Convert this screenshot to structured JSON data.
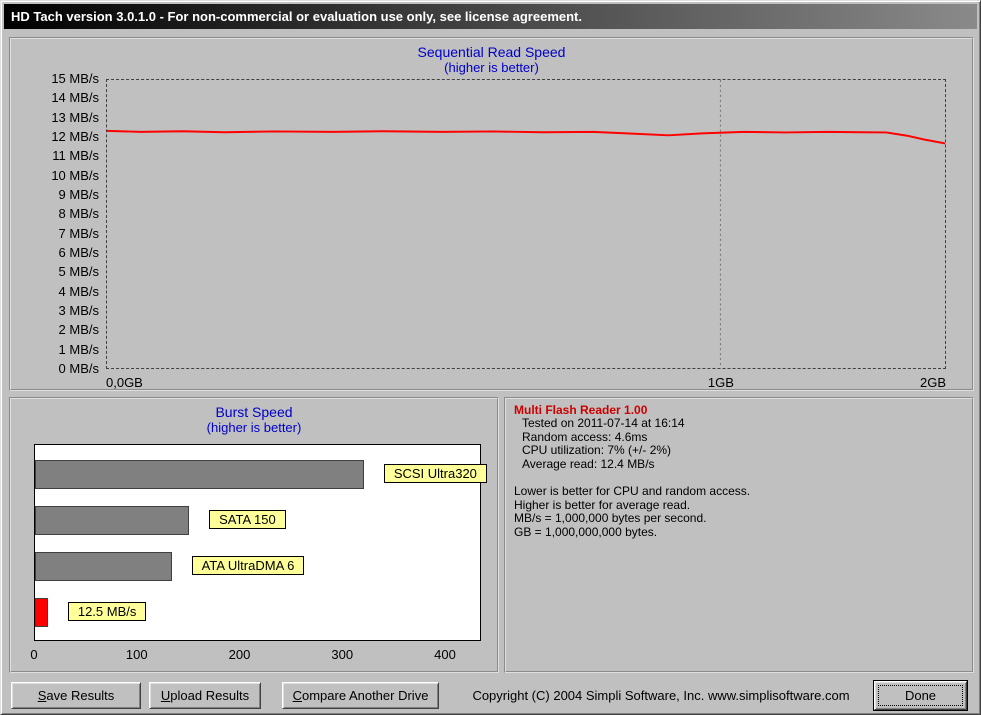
{
  "window": {
    "title": "HD Tach version 3.0.1.0  - For non-commercial or evaluation use only, see license agreement."
  },
  "colors": {
    "accent_blue": "#0000cc",
    "line_red": "#ff0000",
    "bar_gray": "#808080",
    "label_yellow": "#ffff99",
    "drive_title_red": "#cc0000",
    "window_gray": "#c0c0c0"
  },
  "chart_data": [
    {
      "type": "line",
      "title": "Sequential Read Speed",
      "subtitle": "(higher is better)",
      "ylim": [
        0,
        15
      ],
      "ytick_step": 1,
      "ytick_suffix": " MB/s",
      "grid": "dashed-frame",
      "xticks": [
        {
          "label": "0,0GB",
          "pos": 0.0,
          "align": "left"
        },
        {
          "label": "1GB",
          "pos": 0.732,
          "align": "center"
        },
        {
          "label": "2GB",
          "pos": 1.0,
          "align": "right"
        }
      ],
      "gridline_x_positions": [
        0.732
      ],
      "series": [
        {
          "name": "sequential-read-speed",
          "color": "#ff0000",
          "points": [
            [
              0,
              12.35
            ],
            [
              0.04,
              12.3
            ],
            [
              0.09,
              12.33
            ],
            [
              0.14,
              12.28
            ],
            [
              0.2,
              12.32
            ],
            [
              0.27,
              12.3
            ],
            [
              0.33,
              12.33
            ],
            [
              0.4,
              12.3
            ],
            [
              0.46,
              12.32
            ],
            [
              0.52,
              12.28
            ],
            [
              0.58,
              12.3
            ],
            [
              0.63,
              12.2
            ],
            [
              0.67,
              12.12
            ],
            [
              0.71,
              12.22
            ],
            [
              0.76,
              12.3
            ],
            [
              0.81,
              12.27
            ],
            [
              0.86,
              12.3
            ],
            [
              0.9,
              12.28
            ],
            [
              0.93,
              12.27
            ],
            [
              0.955,
              12.1
            ],
            [
              0.975,
              11.9
            ],
            [
              1,
              11.7
            ]
          ]
        }
      ]
    },
    {
      "type": "bar-horizontal",
      "title": "Burst Speed",
      "subtitle": "(higher is better)",
      "xlim": [
        0,
        435
      ],
      "xticks": [
        0,
        100,
        200,
        300,
        400
      ],
      "bars": [
        {
          "label": "SCSI Ultra320",
          "value": 320,
          "color": "#808080"
        },
        {
          "label": "SATA 150",
          "value": 150,
          "color": "#808080"
        },
        {
          "label": "ATA UltraDMA 6",
          "value": 133,
          "color": "#808080"
        },
        {
          "label": "12.5 MB/s",
          "value": 12.5,
          "color": "#ff0000"
        }
      ]
    }
  ],
  "info": {
    "title": "Multi Flash Reader 1.00",
    "details": [
      "Tested on 2011-07-14 at 16:14",
      "Random access: 4.6ms",
      "CPU utilization: 7% (+/- 2%)",
      "Average read: 12.4 MB/s"
    ],
    "notes": [
      "Lower is better for CPU and random access.",
      "Higher is better for average read.",
      "MB/s = 1,000,000 bytes per second.",
      "GB = 1,000,000,000 bytes."
    ]
  },
  "footer": {
    "save": {
      "mn": "S",
      "rest": "ave Results"
    },
    "upload": {
      "mn": "U",
      "rest": "pload Results"
    },
    "compare": {
      "mn": "C",
      "rest": "ompare Another Drive"
    },
    "done": {
      "label": "Done"
    },
    "copyright": "Copyright (C) 2004 Simpli Software, Inc. www.simplisoftware.com"
  }
}
